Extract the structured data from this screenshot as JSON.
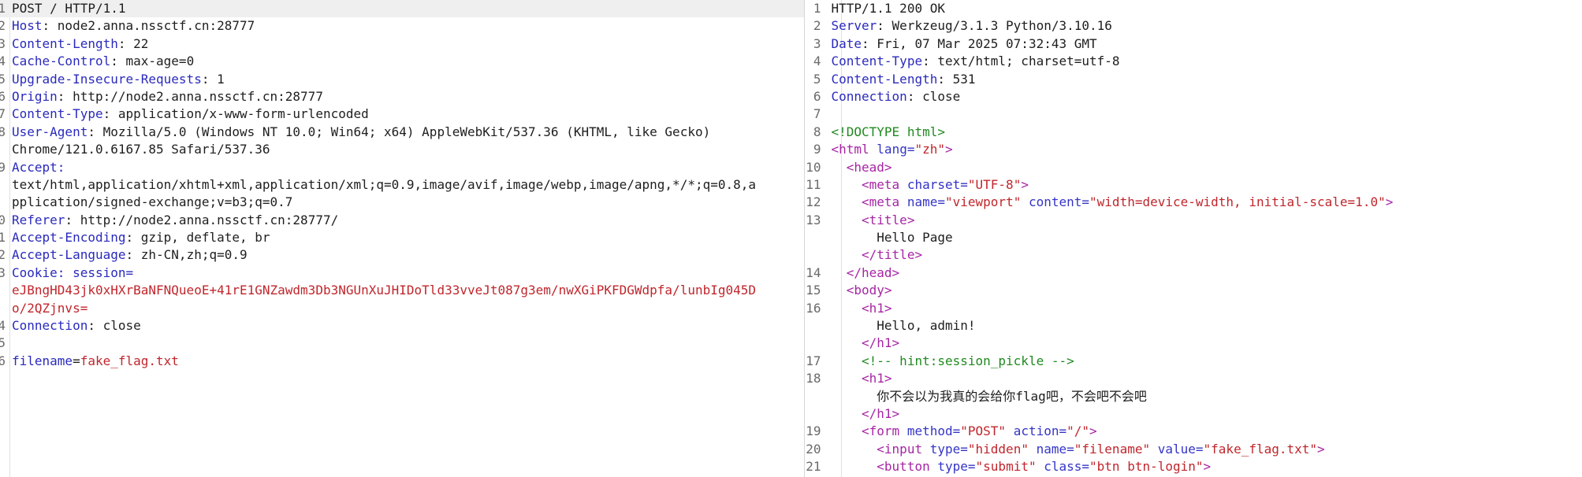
{
  "request": {
    "line1": "POST / HTTP/1.1",
    "headers": [
      {
        "n": "2",
        "name": "Host",
        "value": "node2.anna.nssctf.cn:28777"
      },
      {
        "n": "3",
        "name": "Content-Length",
        "value": "22"
      },
      {
        "n": "4",
        "name": "Cache-Control",
        "value": "max-age=0"
      },
      {
        "n": "5",
        "name": "Upgrade-Insecure-Requests",
        "value": "1"
      },
      {
        "n": "6",
        "name": "Origin",
        "value": "http://node2.anna.nssctf.cn:28777"
      },
      {
        "n": "7",
        "name": "Content-Type",
        "value": "application/x-www-form-urlencoded"
      },
      {
        "n": "8",
        "name": "User-Agent",
        "value": "Mozilla/5.0 (Windows NT 10.0; Win64; x64) AppleWebKit/537.36 (KHTML, like Gecko)",
        "cont": "Chrome/121.0.6167.85 Safari/537.36"
      },
      {
        "n": "9",
        "name": "Accept",
        "value": "",
        "cont": "text/html,application/xhtml+xml,application/xml;q=0.9,image/avif,image/webp,image/apng,*/*;q=0.8,a",
        "cont2": "pplication/signed-exchange;v=b3;q=0.7"
      },
      {
        "n": "0",
        "name": "Referer",
        "value": "http://node2.anna.nssctf.cn:28777/"
      },
      {
        "n": "1",
        "name": "Accept-Encoding",
        "value": "gzip, deflate, br"
      },
      {
        "n": "2",
        "name": "Accept-Language",
        "value": "zh-CN,zh;q=0.9"
      },
      {
        "n": "3",
        "name": "Cookie",
        "value": "session=",
        "cont": "eJBngHD43jk0xHXrBaNFNQueoE+41rE1GNZawdm3Db3NGUnXuJHIDoTld33vveJt087g3em/nwXGiPKFDGWdpfa/lunbIg045D",
        "cont2": "o/2QZjnvs="
      },
      {
        "n": "4",
        "name": "Connection",
        "value": "close"
      }
    ],
    "blank_n": "5",
    "body_n": "6",
    "body_name": "filename",
    "body_value": "fake_flag.txt"
  },
  "response": {
    "lines": [
      {
        "n": "1",
        "text": "HTTP/1.1 200 OK"
      },
      {
        "n": "2",
        "name": "Server",
        "value": "Werkzeug/3.1.3 Python/3.10.16"
      },
      {
        "n": "3",
        "name": "Date",
        "value": "Fri, 07 Mar 2025 07:32:43 GMT"
      },
      {
        "n": "4",
        "name": "Content-Type",
        "value": "text/html; charset=utf-8"
      },
      {
        "n": "5",
        "name": "Content-Length",
        "value": "531"
      },
      {
        "n": "6",
        "name": "Connection",
        "value": "close"
      },
      {
        "n": "7",
        "text": ""
      }
    ],
    "html": {
      "doctype": "<!DOCTYPE html>",
      "html_open": "<html",
      "html_lang_attr": "lang=",
      "html_lang_val": "\"zh\"",
      "head_open": "<head>",
      "meta1": "<meta",
      "meta1_attr": "charset=",
      "meta1_val": "\"UTF-8\"",
      "meta2": "<meta",
      "meta2_attr1": "name=",
      "meta2_val1": "\"viewport\"",
      "meta2_attr2": "content=",
      "meta2_val2": "\"width=device-width, initial-scale=1.0\"",
      "title_open": "<title>",
      "title_text": "Hello Page",
      "title_close": "</title>",
      "head_close": "</head>",
      "body_open": "<body>",
      "h1_open": "<h1>",
      "h1_text": "Hello, admin!",
      "h1_close": "</h1>",
      "comment": "<!-- hint:session_pickle -->",
      "h1b_text": "你不会以为我真的会给你flag吧，不会吧不会吧",
      "form_open": "<form",
      "form_attr1": "method=",
      "form_val1": "\"POST\"",
      "form_attr2": "action=",
      "form_val2": "\"/\"",
      "input_open": "<input",
      "input_attr1": "type=",
      "input_val1": "\"hidden\"",
      "input_attr2": "name=",
      "input_val2": "\"filename\"",
      "input_attr3": "value=",
      "input_val3": "\"fake_flag.txt\"",
      "button_open": "<button",
      "button_attr1": "type=",
      "button_val1": "\"submit\"",
      "button_attr2": "class=",
      "button_val2": "\"btn btn-login\""
    }
  }
}
